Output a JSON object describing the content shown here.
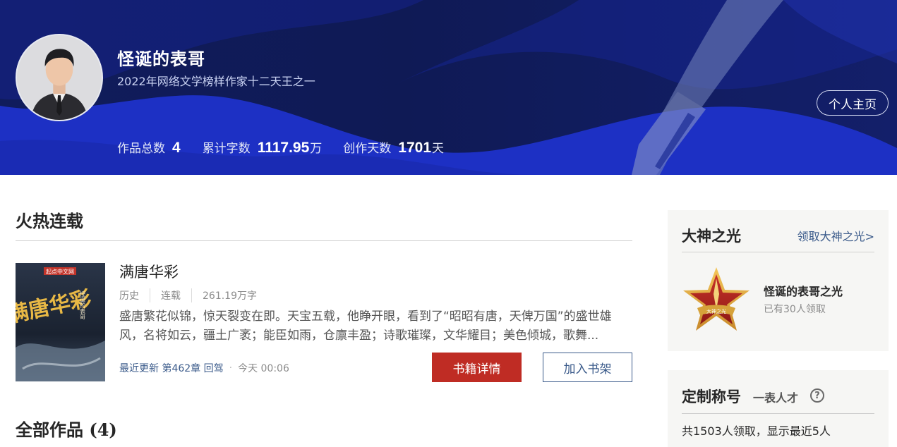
{
  "author": {
    "name": "怪诞的表哥",
    "title": "2022年网络文学榜样作家十二天王之一",
    "home_button": "个人主页"
  },
  "stats": [
    {
      "label": "作品总数",
      "value": "4",
      "unit": ""
    },
    {
      "label": "累计字数",
      "value": "1117.95",
      "unit": "万"
    },
    {
      "label": "创作天数",
      "value": "1701",
      "unit": "天"
    }
  ],
  "hot": {
    "section_title": "火热连载",
    "book": {
      "title": "满唐华彩",
      "cover_text": "满唐华彩",
      "cover_author": "怪诞的表哥",
      "cover_brand": "起点中文网",
      "genre": "历史",
      "status": "连载",
      "words": "261.19万字",
      "description": "盛唐繁花似锦，惊天裂变在即。天宝五载，他睁开眼，看到了“昭昭有唐，天俾万国”的盛世雄风，名将如云，疆土广袤；能臣如雨，仓廪丰盈；诗歌璀璨，文华耀目；美色倾城，歌舞...",
      "latest_update": "最近更新 第462章 回驾",
      "update_time": "今天 00:06",
      "detail_button": "书籍详情",
      "shelf_button": "加入书架"
    }
  },
  "all_works": {
    "section_title": "全部作品 (4)"
  },
  "god_light": {
    "title": "大神之光",
    "link": "领取大神之光>",
    "badge_label": "大神之光",
    "badge_name": "怪诞的表哥之光",
    "badge_count": "已有30人领取"
  },
  "custom_title": {
    "title": "定制称号",
    "tag": "一表人才",
    "help": "?",
    "info": "共1503人领取，显示最近5人"
  },
  "colors": {
    "banner_bg": "#101c5c",
    "accent_blue": "#1a2fc9",
    "detail_button": "#bf2c24",
    "link_blue": "#3a5a8a",
    "card_bg": "#f6f6f4"
  }
}
